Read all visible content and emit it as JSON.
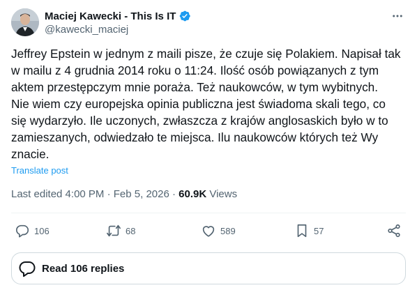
{
  "author": {
    "display_name": "Maciej Kawecki - This Is IT",
    "handle": "@kawecki_maciej",
    "verified": true
  },
  "post": {
    "text": "Jeffrey Epstein w jednym z maili pisze, że czuje się Polakiem. Napisał tak\nw mailu z 4 grudnia 2014 roku o 11:24. Ilość osób powiązanych z tym\naktem przestępczym mnie poraża. Też naukowców, w tym wybitnych.\nNie wiem czy europejska opinia publiczna jest świadoma skali tego, co\nsię wydarzyło. Ile uczonych, zwłaszcza z krajów anglosaskich było w to\nzamieszanych, odwiedzało te miejsca. Ilu naukowców których też Wy\nznacie.",
    "translate_label": "Translate post"
  },
  "meta": {
    "edited": "Last edited 4:00 PM · Feb 5, 2026 · ",
    "views_count": "60.9K",
    "views_label": " Views"
  },
  "actions": {
    "replies": "106",
    "reposts": "68",
    "likes": "589",
    "bookmarks": "57"
  },
  "read_replies": {
    "label": "Read 106 replies"
  },
  "colors": {
    "accent": "#1d9bf0",
    "text": "#0f1419",
    "secondary": "#536471",
    "border": "#cfd9de"
  }
}
